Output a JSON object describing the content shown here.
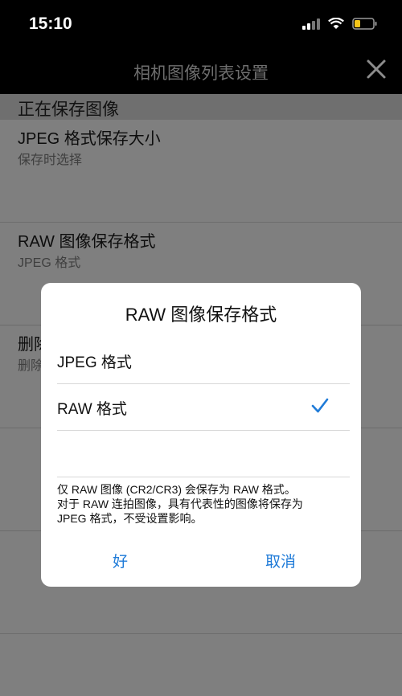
{
  "status": {
    "time": "15:10"
  },
  "nav": {
    "title": "相机图像列表设置"
  },
  "section": {
    "header": "正在保存图像"
  },
  "rows": [
    {
      "title": "JPEG 格式保存大小",
      "sub": "保存时选择"
    },
    {
      "title": "RAW 图像保存格式",
      "sub": "JPEG 格式"
    },
    {
      "title": "删除",
      "sub": "删除"
    }
  ],
  "dialog": {
    "title": "RAW 图像保存格式",
    "options": [
      {
        "label": "JPEG 格式",
        "selected": false
      },
      {
        "label": "RAW 格式",
        "selected": true
      },
      {
        "label": "",
        "selected": false
      }
    ],
    "note_line1": "仅 RAW 图像 (CR2/CR3) 会保存为 RAW 格式。",
    "note_line2": "对于 RAW 连拍图像，具有代表性的图像将保存为",
    "note_line3": "JPEG 格式，不受设置影响。",
    "ok_label": "好",
    "cancel_label": "取消"
  },
  "colors": {
    "accent": "#1f7bd8"
  }
}
